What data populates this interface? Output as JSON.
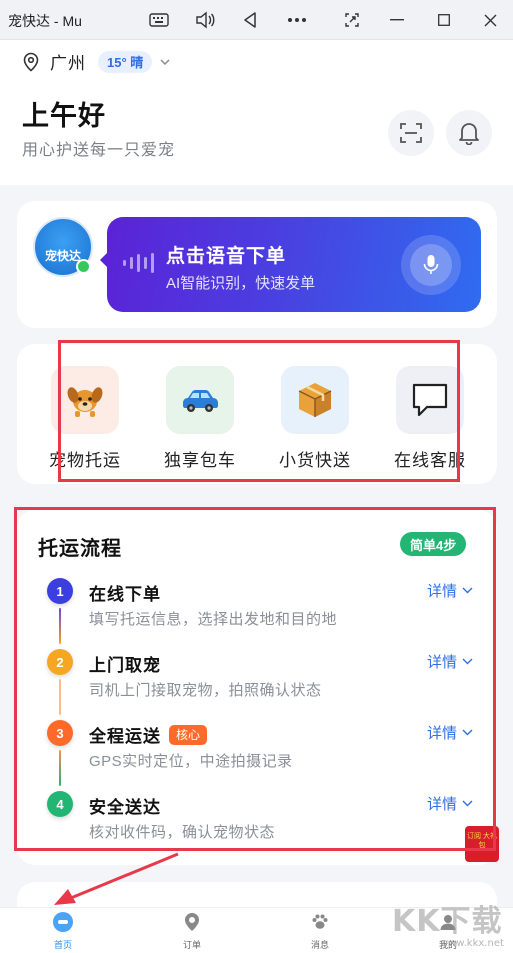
{
  "window": {
    "title": "宠快达 - Mu"
  },
  "header": {
    "city": "广州",
    "weather": "15° 晴",
    "greeting": "上午好",
    "slogan": "用心护送每一只爱宠"
  },
  "voice": {
    "logo_text": "宠快达",
    "title": "点击语音下单",
    "subtitle": "AI智能识别，快速发单"
  },
  "services": [
    {
      "label": "宠物托运",
      "icon": "dog-icon",
      "bg": "#fdece6"
    },
    {
      "label": "独享包车",
      "icon": "car-icon",
      "bg": "#e6f4ea"
    },
    {
      "label": "小货快送",
      "icon": "package-icon",
      "bg": "#e6f1fc"
    },
    {
      "label": "在线客服",
      "icon": "chat-icon",
      "bg": "#eef0f5"
    }
  ],
  "process": {
    "title": "托运流程",
    "badge": "简单4步",
    "detail_label": "详情",
    "steps": [
      {
        "num": "1",
        "title": "在线下单",
        "desc": "填写托运信息，选择出发地和目的地",
        "color": "#3b3fe0"
      },
      {
        "num": "2",
        "title": "上门取宠",
        "desc": "司机上门接取宠物，拍照确认状态",
        "color": "#f5a623"
      },
      {
        "num": "3",
        "title": "全程运送",
        "tag": "核心",
        "desc": "GPS实时定位，中途拍摄记录",
        "color": "#ff6a2b"
      },
      {
        "num": "4",
        "title": "安全送达",
        "desc": "核对收件码，确认宠物状态",
        "color": "#22b573"
      }
    ]
  },
  "promo": {
    "text": "订阅 大礼包"
  },
  "tabbar": [
    {
      "label": "首页",
      "icon": "home-icon",
      "active": true
    },
    {
      "label": "订单",
      "icon": "order-icon",
      "active": false
    },
    {
      "label": "消息",
      "icon": "paw-icon",
      "active": false
    },
    {
      "label": "我的",
      "icon": "user-icon",
      "active": false
    }
  ],
  "watermark": {
    "brand": "KK下载",
    "url": "www.kkx.net"
  },
  "colors": {
    "accent_blue": "#2f6fe4",
    "voice_gradient_start": "#5b23d6",
    "voice_gradient_end": "#2f6cf0",
    "annotation_red": "#e8394b",
    "success_green": "#22b573"
  }
}
